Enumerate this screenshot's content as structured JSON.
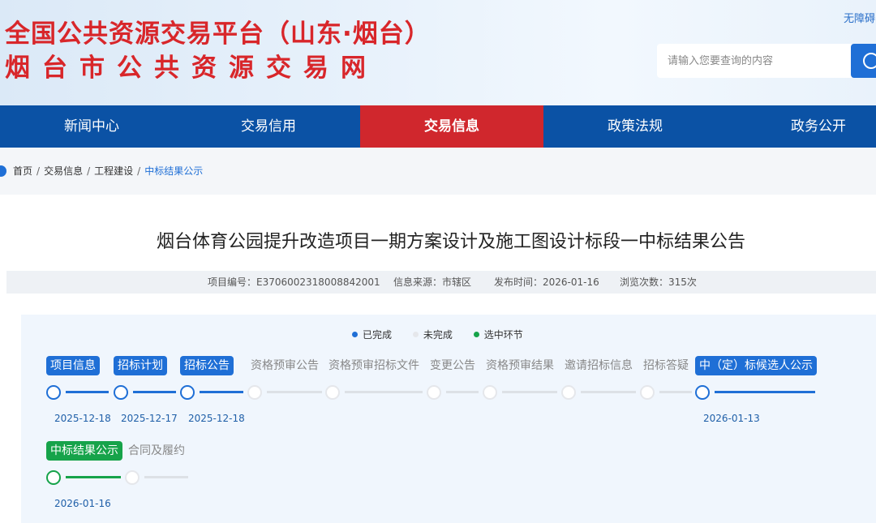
{
  "header": {
    "title_line1": "全国公共资源交易平台（山东·烟台）",
    "title_line2": "烟台市公共资源交易网",
    "a11y_link": "无障碍",
    "search_placeholder": "请输入您要查询的内容"
  },
  "nav": {
    "items": [
      {
        "label": "新闻中心"
      },
      {
        "label": "交易信用"
      },
      {
        "label": "交易信息",
        "active": true
      },
      {
        "label": "政策法规"
      },
      {
        "label": "政务公开"
      }
    ]
  },
  "breadcrumb": {
    "items": [
      "首页",
      "交易信息",
      "工程建设",
      "中标结果公示"
    ]
  },
  "article": {
    "title": "烟台体育公园提升改造项目一期方案设计及施工图设计标段一中标结果公告",
    "meta": {
      "project_no": "项目编号：E3706002318008842001",
      "source": "信息来源：市辖区",
      "publish_time": "发布时间：2026-01-16",
      "views": "浏览次数：315次"
    }
  },
  "progress": {
    "legend": {
      "done": "已完成",
      "todo": "未完成",
      "selected": "选中环节"
    },
    "colors": {
      "done": "#1f6fd6",
      "todo": "#e5e7eb",
      "selected": "#16a34a"
    },
    "steps": [
      {
        "label": "项目信息",
        "status": "done",
        "date": "2025-12-18"
      },
      {
        "label": "招标计划",
        "status": "done",
        "date": "2025-12-17"
      },
      {
        "label": "招标公告",
        "status": "done",
        "date": "2025-12-18"
      },
      {
        "label": "资格预审公告",
        "status": "todo",
        "date": ""
      },
      {
        "label": "资格预审招标文件",
        "status": "todo",
        "date": ""
      },
      {
        "label": "变更公告",
        "status": "todo",
        "date": ""
      },
      {
        "label": "资格预审结果",
        "status": "todo",
        "date": ""
      },
      {
        "label": "邀请招标信息",
        "status": "todo",
        "date": ""
      },
      {
        "label": "招标答疑",
        "status": "todo",
        "date": ""
      },
      {
        "label": "中（定）标候选人公示",
        "status": "done",
        "date": "2026-01-13"
      },
      {
        "label": "中标结果公示",
        "status": "selected",
        "date": "2026-01-16"
      },
      {
        "label": "合同及履约",
        "status": "todo",
        "date": ""
      }
    ]
  }
}
